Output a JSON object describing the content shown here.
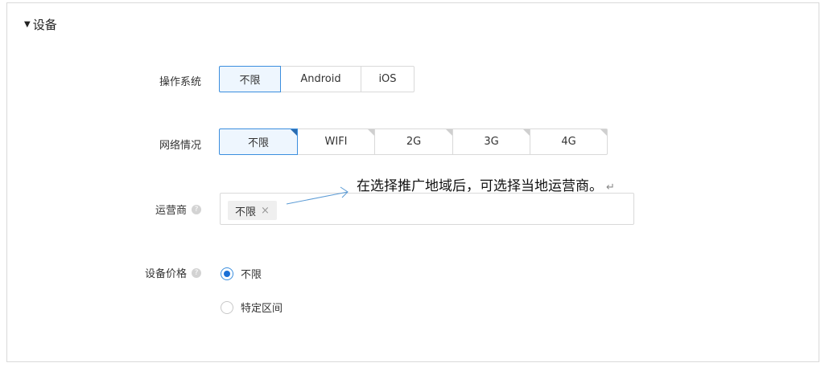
{
  "section": {
    "title": "设备",
    "arrow_icon": "triangle-down-icon"
  },
  "os": {
    "label": "操作系统",
    "options": [
      "不限",
      "Android",
      "iOS"
    ],
    "selected": "不限"
  },
  "network": {
    "label": "网络情况",
    "options": [
      "不限",
      "WIFI",
      "2G",
      "3G",
      "4G"
    ],
    "selected": "不限"
  },
  "carrier": {
    "label": "运营商",
    "help_icon": "question-icon",
    "tag": "不限",
    "remove_icon": "×"
  },
  "price": {
    "label": "设备价格",
    "help_icon": "question-icon",
    "options": [
      "不限",
      "特定区间"
    ],
    "selected": "不限"
  },
  "annotation": {
    "text": "在选择推广地域后，可选择当地运营商。",
    "return_mark": "↵"
  },
  "colors": {
    "accent": "#3b8ede",
    "active_bg": "#eef6fe",
    "border": "#d9d9d9"
  }
}
